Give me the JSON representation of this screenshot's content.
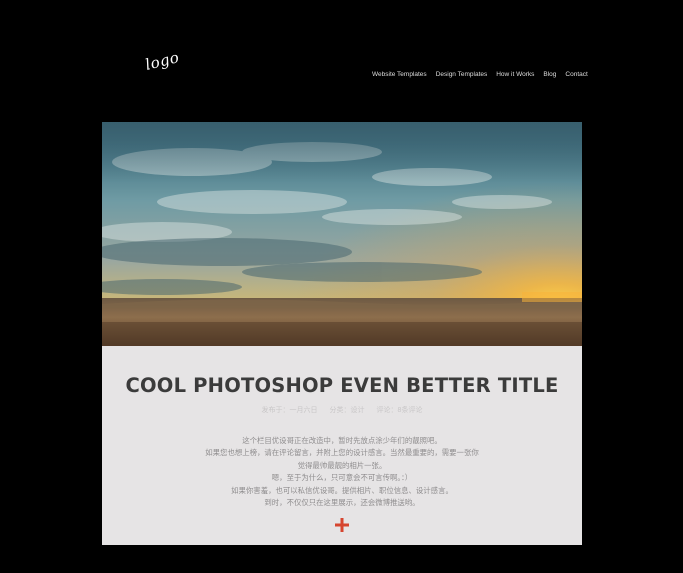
{
  "logo": {
    "text": "logo"
  },
  "nav": {
    "items": [
      "Website Templates",
      "Design Templates",
      "How it Works",
      "Blog",
      "Contact"
    ]
  },
  "hero": {
    "image": "sunset-field-landscape"
  },
  "post": {
    "title": "COOL PHOTOSHOP EVEN BETTER TITLE",
    "meta": {
      "date": "发布于：一月六日",
      "category": "分类：设计",
      "comments": "评论：8条评论"
    },
    "body": [
      "这个栏目优设哥正在改造中，暂时先放点涂少年们的靓照吧。",
      "如果您也想上榜，请在评论留言，并附上您的设计感言。当然最重要的，需要一张你",
      "觉得最帅最靓的相片一张。",
      "嗯，至于为什么，只可意会不可言传啊。：）",
      "如果你害羞，也可以私信优设哥。提供相片、职位信息、设计感言。",
      "到时，不仅仅只在这里展示，还会微博推送哟。"
    ],
    "expand_icon": "plus-icon",
    "accent_color": "#d6452f"
  }
}
